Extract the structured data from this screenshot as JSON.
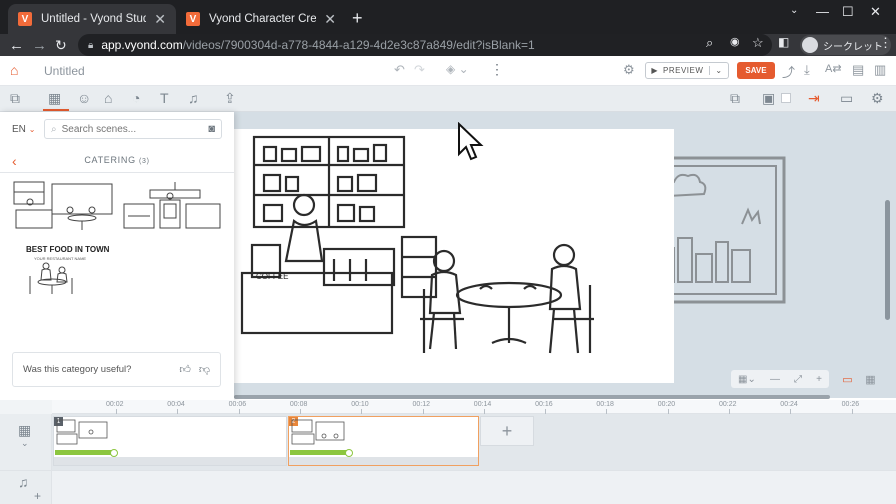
{
  "browser": {
    "tabs": [
      {
        "title": "Untitled - Vyond Studio",
        "favicon": "V",
        "active": true
      },
      {
        "title": "Vyond Character Creator",
        "favicon": "V",
        "active": false
      }
    ],
    "url_host": "app.vyond.com",
    "url_path": "/videos/7900304d-a778-4844-a129-4d2e3c87a849/edit?isBlank=1",
    "profile_label": "シークレット"
  },
  "app": {
    "project_title": "Untitled",
    "preview_label": "PREVIEW",
    "save_label": "SAVE",
    "accent_color": "#e55b2f"
  },
  "scene_panel": {
    "language": "EN",
    "search_placeholder": "Search scenes...",
    "category_title": "CATERING",
    "category_count": "(3)",
    "thumbnails": [
      {
        "name": "cafe-counter-scene"
      },
      {
        "name": "kitchen-scene"
      },
      {
        "name": "restaurant-title-scene",
        "headline": "BEST FOOD IN TOWN",
        "subline": "YOUR RESTAURANT NAME"
      }
    ],
    "feedback_question": "Was this category useful?"
  },
  "canvas": {
    "sign_text": "COFFEE"
  },
  "timeline": {
    "ticks": [
      "00:02",
      "00:04",
      "00:06",
      "00:08",
      "00:10",
      "00:12",
      "00:14",
      "00:16",
      "00:18",
      "00:20",
      "00:22",
      "00:24",
      "00:26"
    ],
    "scenes": [
      {
        "number": "1",
        "selected": false
      },
      {
        "number": "2",
        "selected": true
      }
    ],
    "add_label": "+"
  }
}
